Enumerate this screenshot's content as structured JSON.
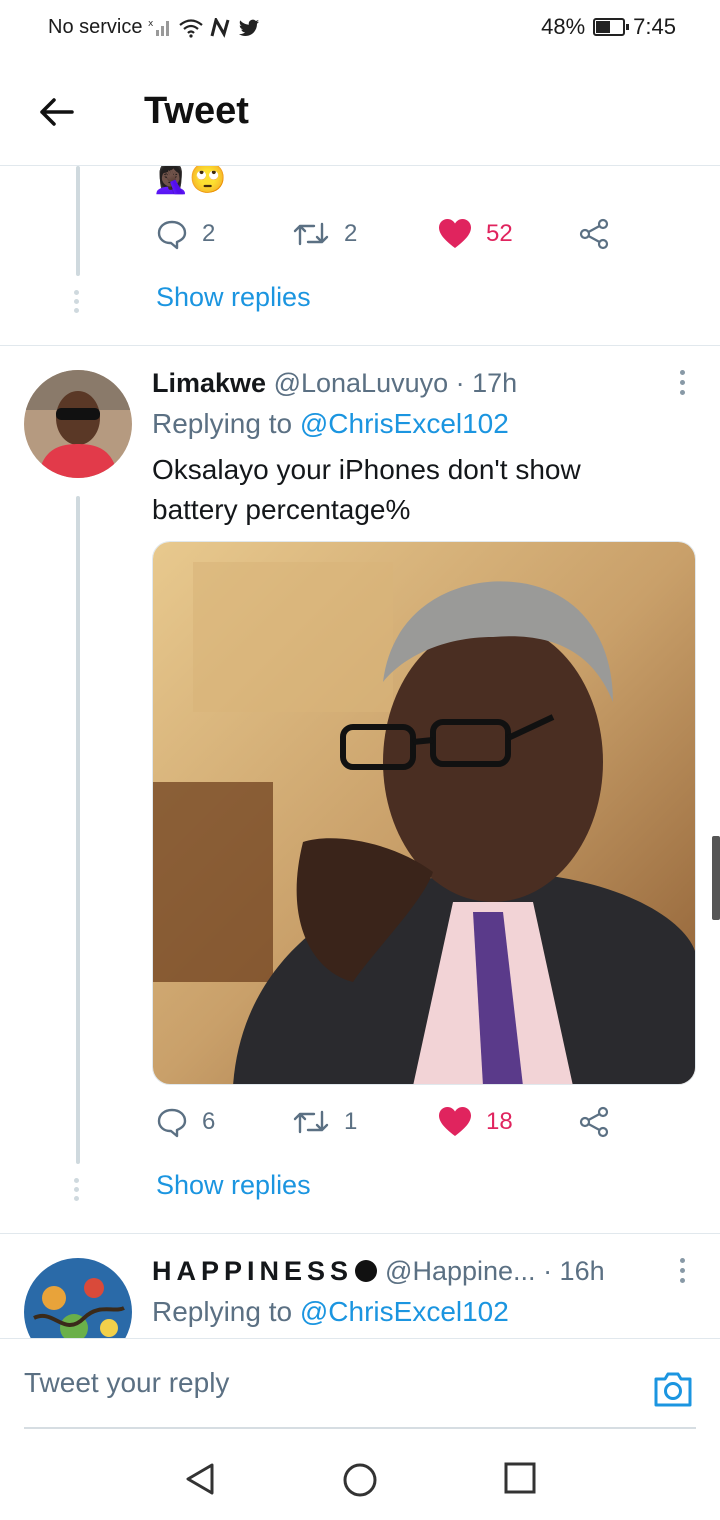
{
  "status_bar": {
    "carrier": "No service",
    "battery_percent": "48%",
    "battery_level": 0.48,
    "time": "7:45"
  },
  "header": {
    "title": "Tweet"
  },
  "tweet_prev": {
    "emoji": "🤦🏿‍♀️🙄",
    "replies": "2",
    "retweets": "2",
    "likes": "52",
    "show_replies": "Show replies"
  },
  "tweet_1": {
    "name": "Limakwe",
    "handle": "@LonaLuvuyo",
    "time": "· 17h",
    "replying_prefix": "Replying to ",
    "replying_to": "@ChrisExcel102",
    "text": "Oksalayo your iPhones don't show battery percentage%",
    "replies": "6",
    "retweets": "1",
    "likes": "18",
    "show_replies": "Show replies"
  },
  "tweet_2": {
    "name": "HAPPINESS",
    "handle": "@Happine...",
    "time": "· 16h",
    "replying_prefix": "Replying to ",
    "replying_to": "@ChrisExcel102"
  },
  "reply_box": {
    "placeholder": "Tweet your reply"
  },
  "colors": {
    "accent": "#1b95e0",
    "like": "#e0245e",
    "muted": "#5b7083"
  }
}
